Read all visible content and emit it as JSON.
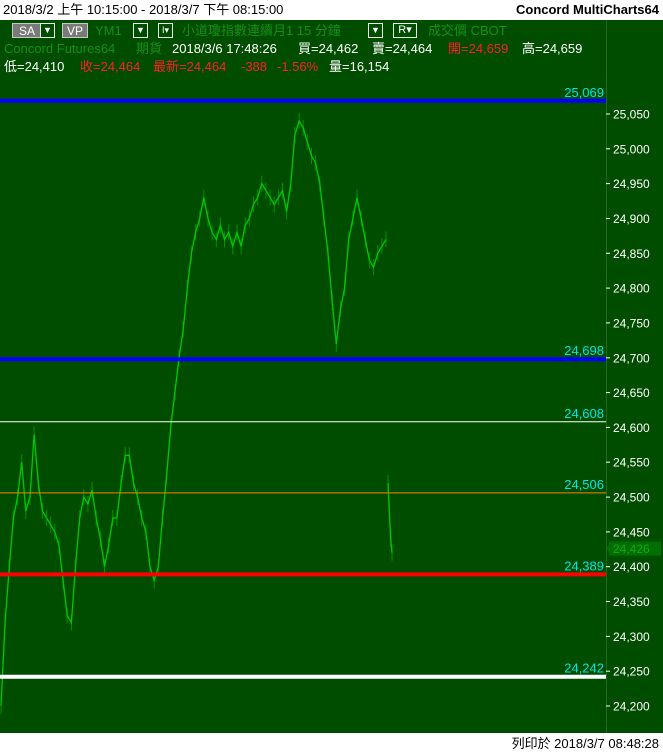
{
  "header": {
    "range_text": "2018/3/2 上午 10:15:00 - 2018/3/7 下午 08:15:00",
    "app_name": "Concord MultiCharts64"
  },
  "toolbar": {
    "sa_label": "SA",
    "vp_label": "VP",
    "symbol": "YM1",
    "interval": "小道瓊指數連續月1 15 分鐘",
    "r_label": "R",
    "tail_text": "成交價 CBOT",
    "source": "Concord Futures64",
    "category": "期貨"
  },
  "quote": {
    "datetime": "2018/3/6 17:48:26",
    "bid": "買=24,462",
    "ask": "賣=24,464",
    "open": "開=24,659",
    "high": "高=24,659",
    "low": "低=24,410",
    "close": "收=24,464",
    "last": "最新=24,464",
    "change": "-388",
    "change_pct": "-1.56%",
    "volume": "量=16,154"
  },
  "footer": {
    "printed": "列印於 2018/3/7 08:48:28"
  },
  "colors": {
    "background": "#004d00",
    "price": "#00c800",
    "level_label": "#00e5e5",
    "axis_text": "#ffffff",
    "current_price_marker": "#006e00"
  },
  "chart_data": {
    "type": "line",
    "title": "",
    "xlabel": "",
    "ylabel": "",
    "ylim": [
      24180,
      25100
    ],
    "y_ticks": [
      24200,
      24250,
      24300,
      24350,
      24400,
      24450,
      24500,
      24550,
      24600,
      24650,
      24700,
      24750,
      24800,
      24850,
      24900,
      24950,
      25000,
      25050
    ],
    "y_tick_labels": [
      "24,200",
      "24,250",
      "24,300",
      "24,350",
      "24,400",
      "24,450",
      "24,500",
      "24,550",
      "24,600",
      "24,650",
      "24,700",
      "24,750",
      "24,800",
      "24,850",
      "24,900",
      "24,950",
      "25,000",
      "25,050"
    ],
    "current_price_label": "24,426",
    "current_price": 24426,
    "grid": false,
    "horizontal_levels": [
      {
        "value": 25069,
        "label": "25,069",
        "color": "#0000ff",
        "width": 4
      },
      {
        "value": 24698,
        "label": "24,698",
        "color": "#0000ff",
        "width": 4
      },
      {
        "value": 24608,
        "label": "24,608",
        "color": "#ffffff",
        "width": 1
      },
      {
        "value": 24506,
        "label": "24,506",
        "color": "#ff8000",
        "width": 1
      },
      {
        "value": 24389,
        "label": "24,389",
        "color": "#ff0000",
        "width": 4
      },
      {
        "value": 24242,
        "label": "24,242",
        "color": "#ffffff",
        "width": 4
      }
    ],
    "price_segments": [
      [
        24200,
        24320,
        24400,
        24470,
        24500,
        24550,
        24480,
        24500,
        24590,
        24520,
        24480,
        24470,
        24460,
        24450,
        24430,
        24380,
        24330,
        24320,
        24400,
        24470,
        24500,
        24490,
        24510,
        24470,
        24440,
        24400,
        24430,
        24470,
        24470,
        24520,
        24560,
        24560,
        24520,
        24500,
        24470,
        24450,
        24400,
        24380,
        24400,
        24470,
        24530,
        24600,
        24650,
        24700,
        24740,
        24800,
        24850,
        24880,
        24900,
        24930,
        24900,
        24880,
        24870,
        24890,
        24870,
        24880,
        24860,
        24880,
        24860,
        24890,
        24900,
        24920,
        24930,
        24950,
        24940,
        24930,
        24920,
        24930,
        24940,
        24910,
        24950,
        25020,
        25040,
        25030,
        25010,
        24990,
        24980,
        24950,
        24900,
        24850,
        24780,
        24720,
        24770,
        24800,
        24870,
        24900,
        24930,
        24900,
        24870,
        24840,
        24830,
        24850,
        24860,
        24870
      ],
      [
        24520,
        24480,
        24440,
        24420
      ]
    ],
    "segment_x_ranges": [
      [
        1,
        386
      ],
      [
        388,
        392
      ]
    ]
  }
}
